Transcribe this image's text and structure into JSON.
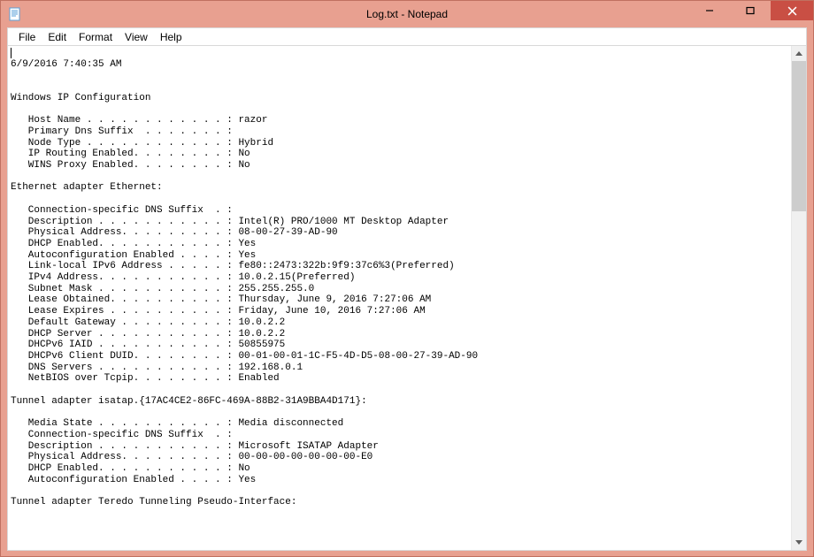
{
  "window": {
    "title": "Log.txt - Notepad"
  },
  "menu": {
    "file": "File",
    "edit": "Edit",
    "format": "Format",
    "view": "View",
    "help": "Help"
  },
  "content": {
    "text": "\n6/9/2016 7:40:35 AM\n\n\nWindows IP Configuration\n\n   Host Name . . . . . . . . . . . . : razor\n   Primary Dns Suffix  . . . . . . . : \n   Node Type . . . . . . . . . . . . : Hybrid\n   IP Routing Enabled. . . . . . . . : No\n   WINS Proxy Enabled. . . . . . . . : No\n\nEthernet adapter Ethernet:\n\n   Connection-specific DNS Suffix  . : \n   Description . . . . . . . . . . . : Intel(R) PRO/1000 MT Desktop Adapter\n   Physical Address. . . . . . . . . : 08-00-27-39-AD-90\n   DHCP Enabled. . . . . . . . . . . : Yes\n   Autoconfiguration Enabled . . . . : Yes\n   Link-local IPv6 Address . . . . . : fe80::2473:322b:9f9:37c6%3(Preferred) \n   IPv4 Address. . . . . . . . . . . : 10.0.2.15(Preferred) \n   Subnet Mask . . . . . . . . . . . : 255.255.255.0\n   Lease Obtained. . . . . . . . . . : Thursday, June 9, 2016 7:27:06 AM\n   Lease Expires . . . . . . . . . . : Friday, June 10, 2016 7:27:06 AM\n   Default Gateway . . . . . . . . . : 10.0.2.2\n   DHCP Server . . . . . . . . . . . : 10.0.2.2\n   DHCPv6 IAID . . . . . . . . . . . : 50855975\n   DHCPv6 Client DUID. . . . . . . . : 00-01-00-01-1C-F5-4D-D5-08-00-27-39-AD-90\n   DNS Servers . . . . . . . . . . . : 192.168.0.1\n   NetBIOS over Tcpip. . . . . . . . : Enabled\n\nTunnel adapter isatap.{17AC4CE2-86FC-469A-88B2-31A9BBA4D171}:\n\n   Media State . . . . . . . . . . . : Media disconnected\n   Connection-specific DNS Suffix  . : \n   Description . . . . . . . . . . . : Microsoft ISATAP Adapter\n   Physical Address. . . . . . . . . : 00-00-00-00-00-00-00-E0\n   DHCP Enabled. . . . . . . . . . . : No\n   Autoconfiguration Enabled . . . . : Yes\n\nTunnel adapter Teredo Tunneling Pseudo-Interface:"
  }
}
